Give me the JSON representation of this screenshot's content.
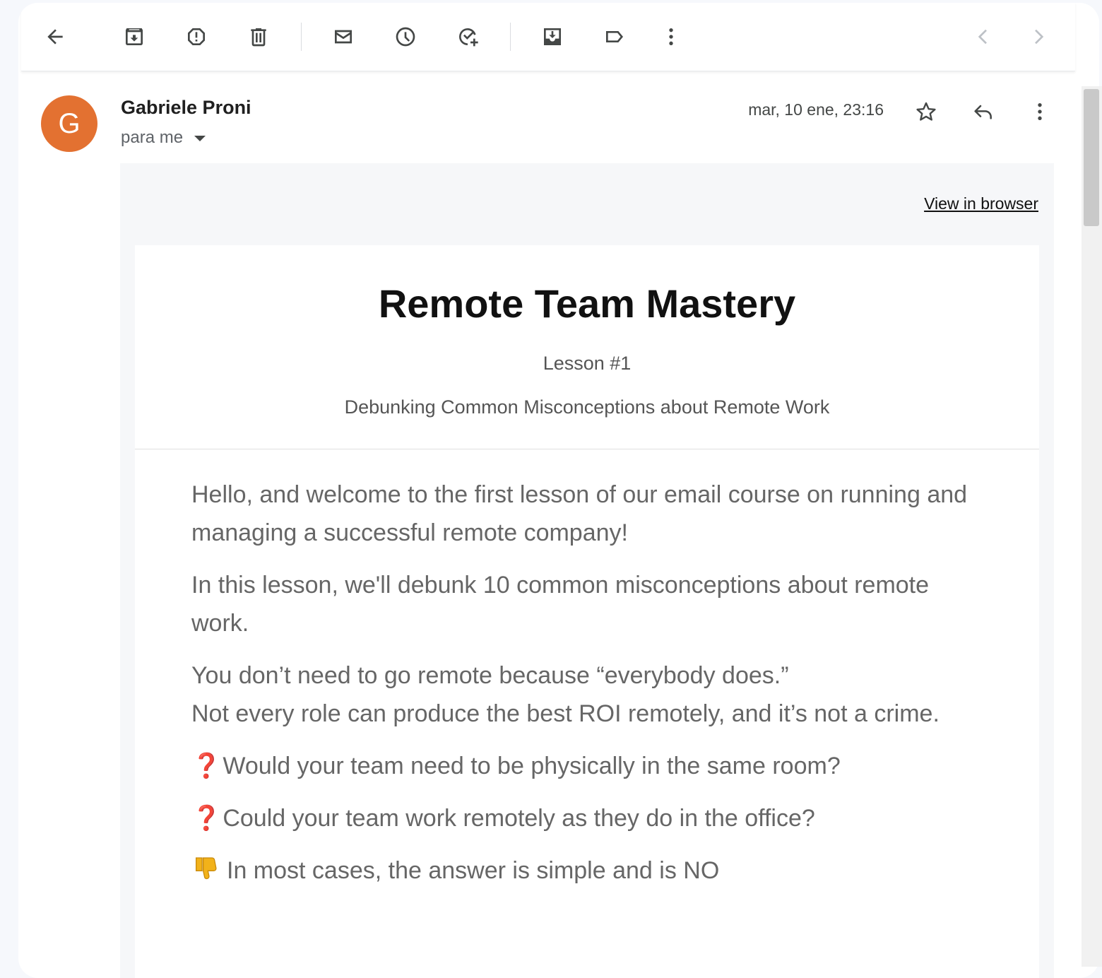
{
  "toolbar": {
    "back": "back-arrow-icon",
    "archive": "archive-icon",
    "spam": "report-spam-icon",
    "delete": "trash-icon",
    "mark_unread": "mail-icon",
    "snooze": "clock-icon",
    "add_task": "add-task-icon",
    "move_to": "move-to-icon",
    "label": "label-icon",
    "more": "more-vert-icon",
    "prev": "chevron-left-icon",
    "next": "chevron-right-icon"
  },
  "message": {
    "avatar_letter": "G",
    "avatar_color": "#e37131",
    "sender": "Gabriele Proni",
    "recipient": "para me",
    "date": "mar, 10 ene, 23:16"
  },
  "newsletter": {
    "view_in_browser": "View in browser",
    "title": "Remote Team Mastery",
    "lesson": "Lesson #1",
    "subtitle": "Debunking Common Misconceptions about Remote Work",
    "p1": "Hello, and welcome to the first lesson of our email course on running and managing a successful remote company!",
    "p2": "In this lesson, we'll debunk 10 common misconceptions about remote work.",
    "p3_line1": "You don’t need to go remote because “everybody does.”",
    "p3_line2": "Not every role can produce the best ROI remotely, and it’s not a crime.",
    "q1_mark": "❓",
    "q1": "Would your team need to be physically in the same room?",
    "q2_mark": "❓",
    "q2": "Could your team work remotely as they do in the office?",
    "answer": "In most cases, the answer is simple and is NO"
  }
}
